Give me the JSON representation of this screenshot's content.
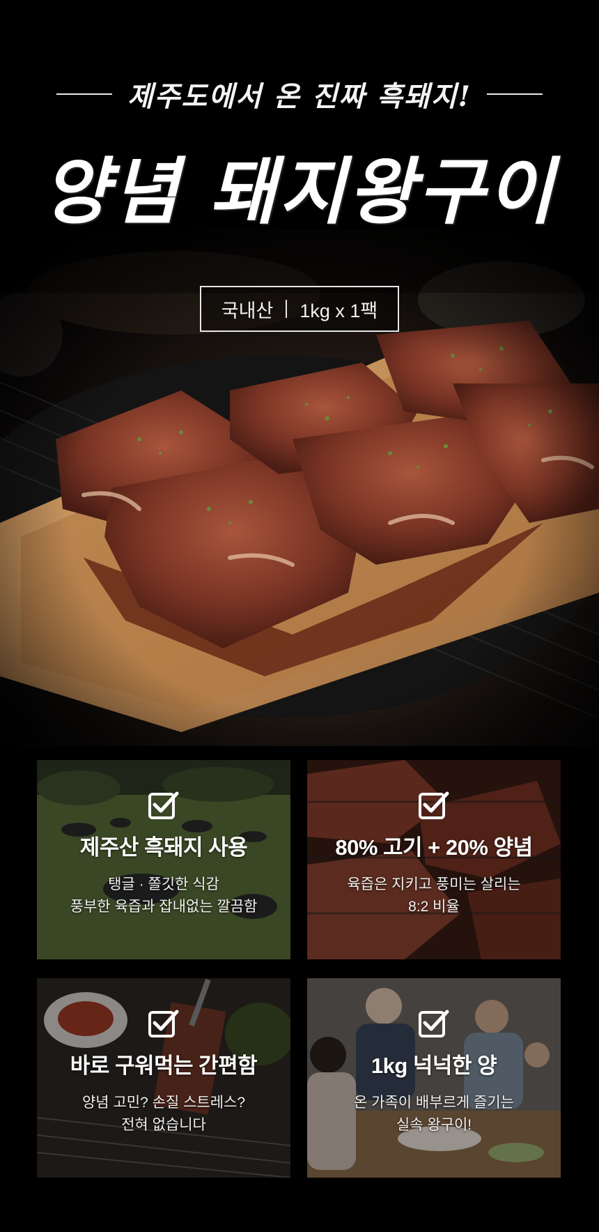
{
  "header": {
    "subtitle": "제주도에서 온 진짜 흑돼지!",
    "title": "양념 돼지왕구이"
  },
  "origin": {
    "country": "국내산",
    "package": "1kg x 1팩"
  },
  "features": [
    {
      "title": "제주산 흑돼지 사용",
      "lines": [
        "탱글 · 쫄깃한 식감",
        "풍부한 육즙과 잡내없는 깔끔함"
      ]
    },
    {
      "title": "80% 고기 + 20% 양념",
      "lines": [
        "육즙은 지키고 풍미는 살리는",
        "8:2 비율"
      ]
    },
    {
      "title": "바로 구워먹는 간편함",
      "lines": [
        "양념 고민? 손질 스트레스?",
        "전혀 없습니다"
      ]
    },
    {
      "title": "1kg 넉넉한 양",
      "lines": [
        "온 가족이 배부르게 즐기는",
        "실속 왕구이!"
      ]
    }
  ],
  "icons": {
    "check": "checkbox-check-icon"
  },
  "colors": {
    "background": "#000000",
    "text": "#ffffff",
    "meat": "#8a3e2c",
    "board": "#c8935a"
  }
}
